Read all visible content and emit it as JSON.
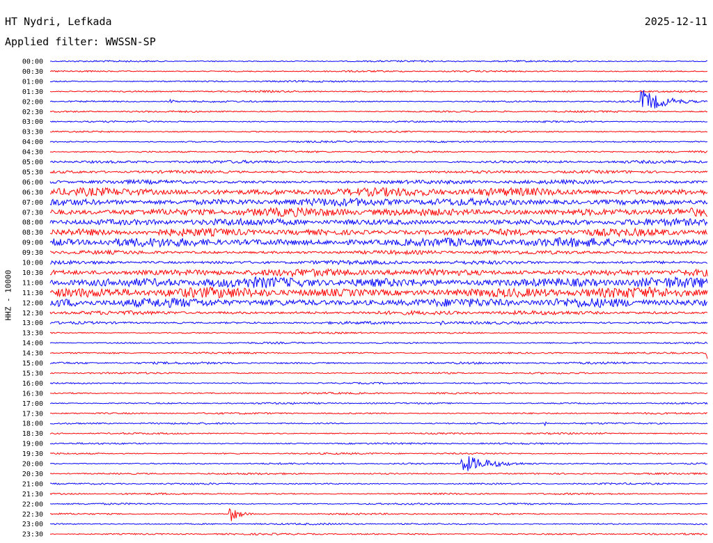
{
  "header": {
    "station": "HT Nydri, Lefkada",
    "filter": "Applied filter: WWSSN-SP",
    "date": "2025-12-11"
  },
  "channel_label": "HHZ - 10000",
  "colors": {
    "even": "#0000ff",
    "odd": "#ff0000",
    "background": "#ffffff",
    "text": "#000000"
  },
  "chart_data": {
    "type": "line",
    "title": "HT Nydri, Lefkada",
    "subtitle": "Applied filter: WWSSN-SP",
    "ylabel": "HHZ - 10000",
    "rows": [
      "00:00",
      "00:30",
      "01:00",
      "01:30",
      "02:00",
      "02:30",
      "03:00",
      "03:30",
      "04:00",
      "04:30",
      "05:00",
      "05:30",
      "06:00",
      "06:30",
      "07:00",
      "07:30",
      "08:00",
      "08:30",
      "09:00",
      "09:30",
      "10:00",
      "10:30",
      "11:00",
      "11:30",
      "12:00",
      "12:30",
      "13:00",
      "13:30",
      "14:00",
      "14:30",
      "15:00",
      "15:30",
      "16:00",
      "16:30",
      "17:00",
      "17:30",
      "18:00",
      "18:30",
      "19:00",
      "19:30",
      "20:00",
      "20:30",
      "21:00",
      "21:30",
      "22:00",
      "22:30",
      "23:00",
      "23:30"
    ],
    "row_minutes": 30,
    "noise_level": [
      0.3,
      0.3,
      0.3,
      0.3,
      0.3,
      0.3,
      0.3,
      0.3,
      0.3,
      0.35,
      0.5,
      0.5,
      0.7,
      1.5,
      1.4,
      1.5,
      1.2,
      1.3,
      1.6,
      0.7,
      0.7,
      1.3,
      1.8,
      1.8,
      1.6,
      0.7,
      0.5,
      0.3,
      0.3,
      0.3,
      0.4,
      0.3,
      0.3,
      0.3,
      0.3,
      0.3,
      0.3,
      0.3,
      0.3,
      0.3,
      0.3,
      0.3,
      0.3,
      0.3,
      0.3,
      0.3,
      0.3,
      0.3
    ],
    "events": [
      {
        "row": 4,
        "minute": 5.5,
        "amplitude": 1.3,
        "duration_min": 0.5
      },
      {
        "row": 4,
        "minute": 15.2,
        "amplitude": 0.5,
        "duration_min": 0.3
      },
      {
        "row": 4,
        "minute": 27.0,
        "amplitude": 5.5,
        "duration_min": 3.2
      },
      {
        "row": 26,
        "minute": 17.8,
        "amplitude": 1.0,
        "duration_min": 2.5
      },
      {
        "row": 36,
        "minute": 22.6,
        "amplitude": 1.0,
        "duration_min": 0.4
      },
      {
        "row": 40,
        "minute": 18.8,
        "amplitude": 4.2,
        "duration_min": 4.0
      },
      {
        "row": 45,
        "minute": 8.2,
        "amplitude": 4.0,
        "duration_min": 1.3
      },
      {
        "row": 29,
        "minute": 30.0,
        "amplitude": 10.0,
        "duration_min": 0.2
      }
    ]
  }
}
